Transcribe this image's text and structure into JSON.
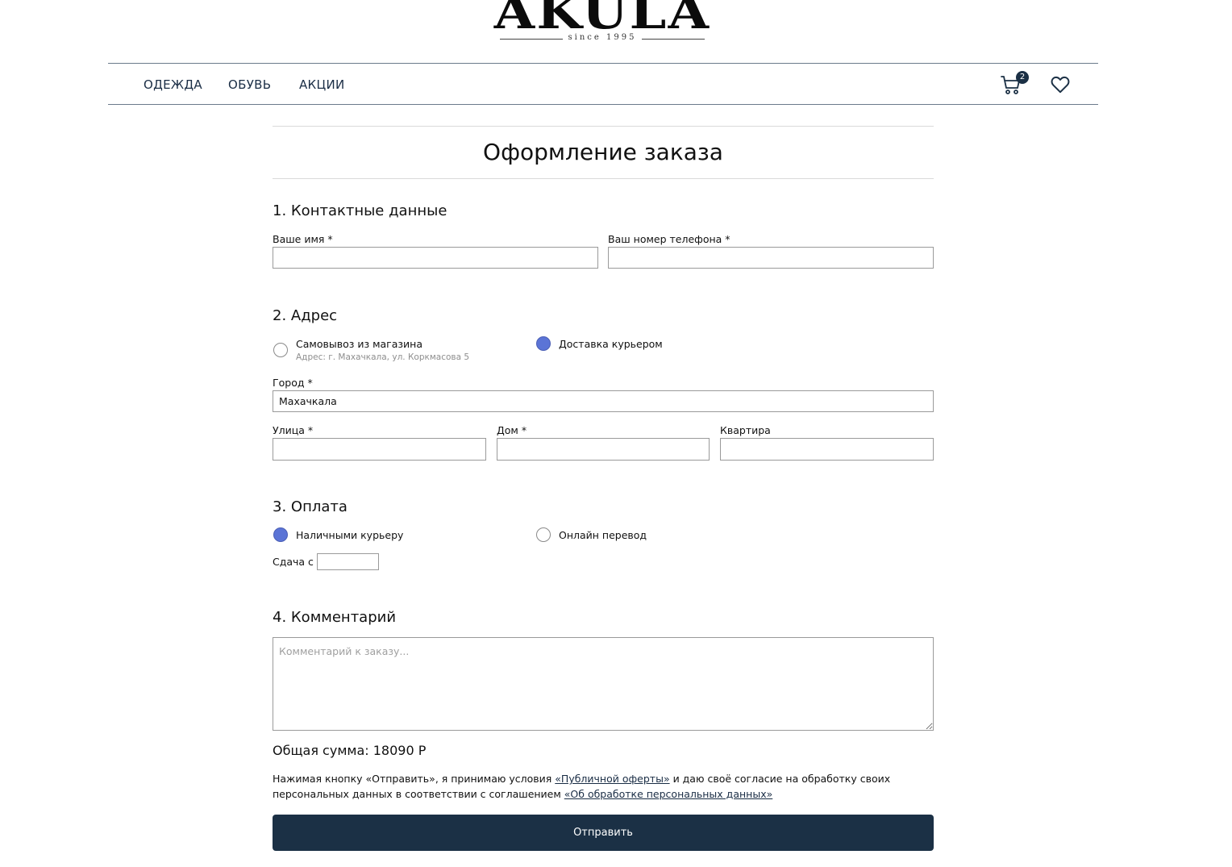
{
  "brand": {
    "name": "AKULA",
    "tagline": "since 1995"
  },
  "nav": {
    "items": [
      {
        "label": "ОДЕЖДА"
      },
      {
        "label": "ОБУВЬ"
      },
      {
        "label": "АКЦИИ"
      }
    ],
    "cart_count": "2",
    "cart_icon": "cart-icon",
    "favorites_icon": "heart-icon"
  },
  "page": {
    "title": "Оформление заказа"
  },
  "contacts": {
    "title": "1. Контактные данные",
    "name_label": "Ваше имя *",
    "name_value": "",
    "phone_label": "Ваш номер телефона *",
    "phone_value": ""
  },
  "address": {
    "title": "2. Адрес",
    "options": [
      {
        "label": "Самовывоз из магазина",
        "sub": "Адрес: г. Махачкала, ул. Коркмасова 5",
        "checked": false
      },
      {
        "label": "Доставка курьером",
        "checked": true
      }
    ],
    "city_label": "Город *",
    "city_value": "Махачкала",
    "street_label": "Улица *",
    "street_value": "",
    "house_label": "Дом *",
    "house_value": "",
    "apartment_label": "Квартира",
    "apartment_value": ""
  },
  "payment": {
    "title": "3. Оплата",
    "options": [
      {
        "label": "Наличными курьеру",
        "checked": true
      },
      {
        "label": "Онлайн перевод",
        "checked": false
      }
    ],
    "change_label": "Сдача с",
    "change_value": ""
  },
  "comment": {
    "title": "4. Комментарий",
    "placeholder": "Комментарий к заказу..."
  },
  "total": {
    "text": "Общая сумма: 18090 Р"
  },
  "consent": {
    "text_1": "Нажимая кнопку «Отправить», я принимаю условия ",
    "link_1": "«Публичной оферты»",
    "text_2": " и даю своё согласие на обработку своих персональных данных в соответствии с соглашением ",
    "link_2": "«Об обработке персональных данных»"
  },
  "submit_label": "Отправить",
  "colors": {
    "accent": "#1b3045",
    "radio_checked": "#5b74d6",
    "nav_text": "#1a2d45"
  }
}
